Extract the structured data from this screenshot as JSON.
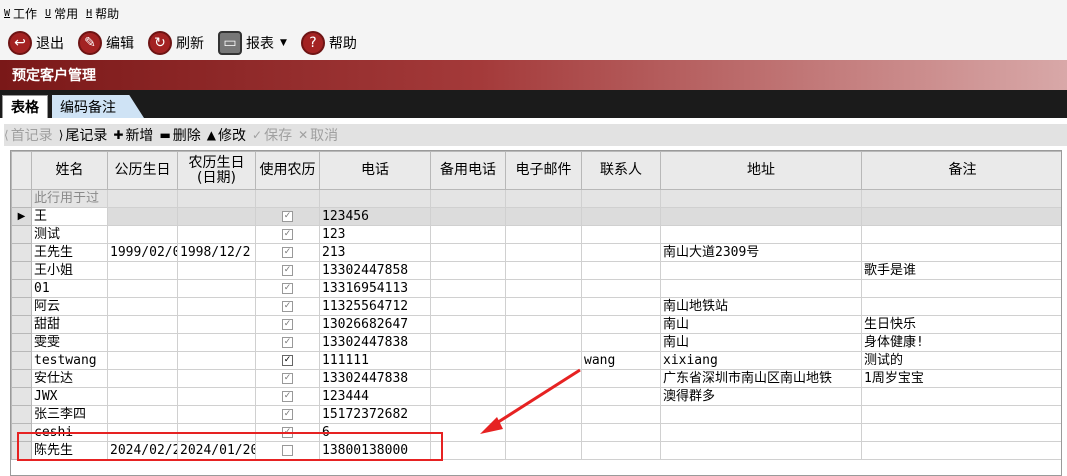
{
  "menu": [
    {
      "key": "W",
      "label": "工作"
    },
    {
      "key": "U",
      "label": "常用"
    },
    {
      "key": "H",
      "label": "帮助"
    }
  ],
  "toolbar": {
    "exit": "退出",
    "edit": "编辑",
    "refresh": "刷新",
    "report": "报表",
    "help": "帮助"
  },
  "title": "预定客户管理",
  "tabs": {
    "table": "表格",
    "notes": "编码备注"
  },
  "nav": {
    "first": "首记录",
    "last": "尾记录",
    "add": "新增",
    "delete": "删除",
    "modify": "修改",
    "save": "保存",
    "cancel": "取消"
  },
  "columns": [
    "姓名",
    "公历生日",
    "农历生日(日期)",
    "使用农历",
    "电话",
    "备用电话",
    "电子邮件",
    "联系人",
    "地址",
    "备注"
  ],
  "filter_placeholder": "此行用于过",
  "rows": [
    {
      "name": "王",
      "solar": "",
      "lunar": "",
      "use_lunar": true,
      "phone": "123456",
      "alt": "",
      "email": "",
      "contact": "",
      "addr": "",
      "note": "",
      "selected": true
    },
    {
      "name": "测试",
      "solar": "",
      "lunar": "",
      "use_lunar": true,
      "phone": "123",
      "alt": "",
      "email": "",
      "contact": "",
      "addr": "",
      "note": ""
    },
    {
      "name": "王先生",
      "solar": "1999/02/0",
      "lunar": "1998/12/2",
      "use_lunar": true,
      "phone": "213",
      "alt": "",
      "email": "",
      "contact": "",
      "addr": "南山大道2309号",
      "note": ""
    },
    {
      "name": "王小姐",
      "solar": "",
      "lunar": "",
      "use_lunar": true,
      "phone": "13302447858",
      "alt": "",
      "email": "",
      "contact": "",
      "addr": "",
      "note": "歌手是谁"
    },
    {
      "name": "01",
      "solar": "",
      "lunar": "",
      "use_lunar": true,
      "phone": "13316954113",
      "alt": "",
      "email": "",
      "contact": "",
      "addr": "",
      "note": ""
    },
    {
      "name": "阿云",
      "solar": "",
      "lunar": "",
      "use_lunar": true,
      "phone": "11325564712",
      "alt": "",
      "email": "",
      "contact": "",
      "addr": "南山地铁站",
      "note": ""
    },
    {
      "name": "甜甜",
      "solar": "",
      "lunar": "",
      "use_lunar": true,
      "phone": "13026682647",
      "alt": "",
      "email": "",
      "contact": "",
      "addr": "南山",
      "note": "生日快乐"
    },
    {
      "name": "雯雯",
      "solar": "",
      "lunar": "",
      "use_lunar": true,
      "phone": "13302447838",
      "alt": "",
      "email": "",
      "contact": "",
      "addr": "南山",
      "note": "身体健康!"
    },
    {
      "name": "testwang",
      "solar": "",
      "lunar": "",
      "use_lunar": true,
      "strong": true,
      "phone": "111111",
      "alt": "",
      "email": "",
      "contact": "wang",
      "addr": "xixiang",
      "note": "测试的"
    },
    {
      "name": "安仕达",
      "solar": "",
      "lunar": "",
      "use_lunar": true,
      "phone": "13302447838",
      "alt": "",
      "email": "",
      "contact": "",
      "addr": "广东省深圳市南山区南山地铁",
      "note": "1周岁宝宝"
    },
    {
      "name": "JWX",
      "solar": "",
      "lunar": "",
      "use_lunar": true,
      "phone": "123444",
      "alt": "",
      "email": "",
      "contact": "",
      "addr": "澳得群多",
      "note": ""
    },
    {
      "name": "张三李四",
      "solar": "",
      "lunar": "",
      "use_lunar": true,
      "phone": "15172372682",
      "alt": "",
      "email": "",
      "contact": "",
      "addr": "",
      "note": ""
    },
    {
      "name": "ceshi",
      "solar": "",
      "lunar": "",
      "use_lunar": true,
      "phone": "6",
      "alt": "",
      "email": "",
      "contact": "",
      "addr": "",
      "note": ""
    },
    {
      "name": "陈先生",
      "solar": "2024/02/2",
      "lunar": "2024/01/20",
      "use_lunar": false,
      "phone": "13800138000",
      "alt": "",
      "email": "",
      "contact": "",
      "addr": "",
      "note": ""
    }
  ]
}
